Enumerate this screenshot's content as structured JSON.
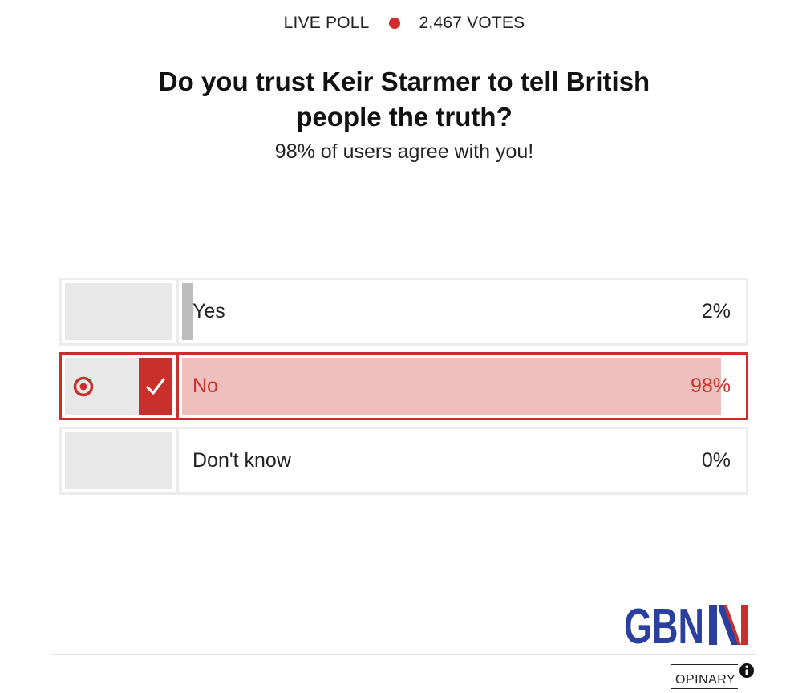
{
  "header": {
    "live_label": "LIVE POLL",
    "votes": "2,467 VOTES"
  },
  "question": {
    "line1": "Do you trust Keir Starmer to tell British",
    "line2": "people the truth?"
  },
  "subtitle": "98% of users agree with you!",
  "options": [
    {
      "label": "Yes",
      "percent": "2%",
      "fraction": 0.02,
      "selected": false
    },
    {
      "label": "No",
      "percent": "98%",
      "fraction": 0.98,
      "selected": true
    },
    {
      "label": "Don't know",
      "percent": "0%",
      "fraction": 0.0,
      "selected": false
    }
  ],
  "brand": {
    "logo": "GBN",
    "footer": "OPINARY"
  },
  "colors": {
    "accent": "#c9302c",
    "selected_bar": "#efbfbd",
    "unselected_bar": "#bdbdbd",
    "logo_blue": "#2b3f9e"
  },
  "icons": [
    "radio-selected-icon",
    "checkmark-icon",
    "info-icon"
  ]
}
